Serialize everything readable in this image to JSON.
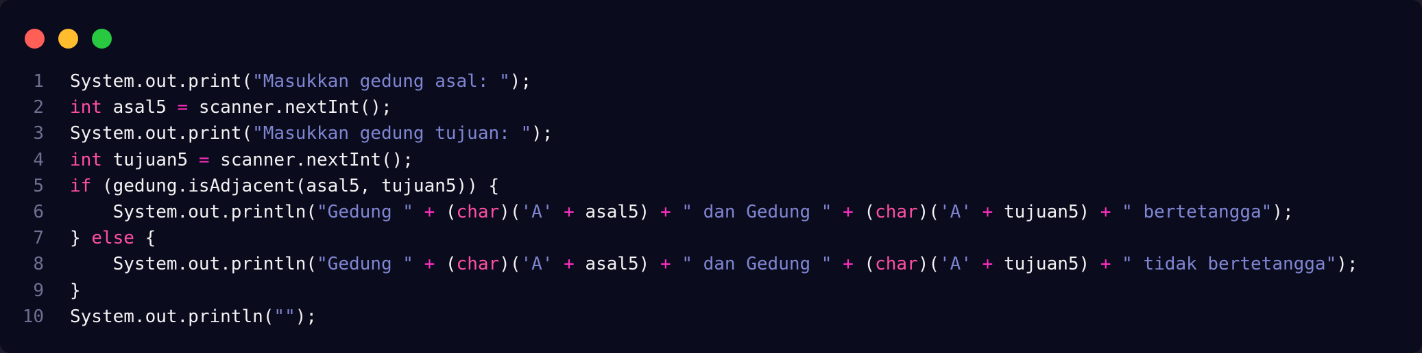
{
  "window": {
    "traffic_lights": [
      {
        "name": "close",
        "color": "#ff5f57"
      },
      {
        "name": "minimize",
        "color": "#febc2e"
      },
      {
        "name": "zoom",
        "color": "#28c840"
      }
    ]
  },
  "colors": {
    "background": "#0b0b1e",
    "keyword": "#ff4fa3",
    "string": "#7f86d2",
    "operator": "#ff2fc0",
    "line_number": "#6e7191",
    "text": "#f2f2f2"
  },
  "code": {
    "lines": [
      {
        "num": "1",
        "tokens": [
          {
            "t": "System.out.print(",
            "k": "plain"
          },
          {
            "t": "\"Masukkan gedung asal: \"",
            "k": "str"
          },
          {
            "t": ");",
            "k": "plain"
          }
        ]
      },
      {
        "num": "2",
        "tokens": [
          {
            "t": "int",
            "k": "kw"
          },
          {
            "t": " asal5 ",
            "k": "plain"
          },
          {
            "t": "=",
            "k": "op"
          },
          {
            "t": " scanner.nextInt();",
            "k": "plain"
          }
        ]
      },
      {
        "num": "3",
        "tokens": [
          {
            "t": "System.out.print(",
            "k": "plain"
          },
          {
            "t": "\"Masukkan gedung tujuan: \"",
            "k": "str"
          },
          {
            "t": ");",
            "k": "plain"
          }
        ]
      },
      {
        "num": "4",
        "tokens": [
          {
            "t": "int",
            "k": "kw"
          },
          {
            "t": " tujuan5 ",
            "k": "plain"
          },
          {
            "t": "=",
            "k": "op"
          },
          {
            "t": " scanner.nextInt();",
            "k": "plain"
          }
        ]
      },
      {
        "num": "5",
        "tokens": [
          {
            "t": "if",
            "k": "kw"
          },
          {
            "t": " (gedung.isAdjacent(asal5, tujuan5)) {",
            "k": "plain"
          }
        ]
      },
      {
        "num": "6",
        "tokens": [
          {
            "t": "    System.out.println(",
            "k": "plain"
          },
          {
            "t": "\"Gedung \"",
            "k": "str"
          },
          {
            "t": " ",
            "k": "plain"
          },
          {
            "t": "+",
            "k": "op"
          },
          {
            "t": " (",
            "k": "plain"
          },
          {
            "t": "char",
            "k": "kw"
          },
          {
            "t": ")(",
            "k": "plain"
          },
          {
            "t": "'A'",
            "k": "str"
          },
          {
            "t": " ",
            "k": "plain"
          },
          {
            "t": "+",
            "k": "op"
          },
          {
            "t": " asal5) ",
            "k": "plain"
          },
          {
            "t": "+",
            "k": "op"
          },
          {
            "t": " ",
            "k": "plain"
          },
          {
            "t": "\" dan Gedung \"",
            "k": "str"
          },
          {
            "t": " ",
            "k": "plain"
          },
          {
            "t": "+",
            "k": "op"
          },
          {
            "t": " (",
            "k": "plain"
          },
          {
            "t": "char",
            "k": "kw"
          },
          {
            "t": ")(",
            "k": "plain"
          },
          {
            "t": "'A'",
            "k": "str"
          },
          {
            "t": " ",
            "k": "plain"
          },
          {
            "t": "+",
            "k": "op"
          },
          {
            "t": " tujuan5) ",
            "k": "plain"
          },
          {
            "t": "+",
            "k": "op"
          },
          {
            "t": " ",
            "k": "plain"
          },
          {
            "t": "\" bertetangga\"",
            "k": "str"
          },
          {
            "t": ");",
            "k": "plain"
          }
        ]
      },
      {
        "num": "7",
        "tokens": [
          {
            "t": "} ",
            "k": "plain"
          },
          {
            "t": "else",
            "k": "kw"
          },
          {
            "t": " {",
            "k": "plain"
          }
        ]
      },
      {
        "num": "8",
        "tokens": [
          {
            "t": "    System.out.println(",
            "k": "plain"
          },
          {
            "t": "\"Gedung \"",
            "k": "str"
          },
          {
            "t": " ",
            "k": "plain"
          },
          {
            "t": "+",
            "k": "op"
          },
          {
            "t": " (",
            "k": "plain"
          },
          {
            "t": "char",
            "k": "kw"
          },
          {
            "t": ")(",
            "k": "plain"
          },
          {
            "t": "'A'",
            "k": "str"
          },
          {
            "t": " ",
            "k": "plain"
          },
          {
            "t": "+",
            "k": "op"
          },
          {
            "t": " asal5) ",
            "k": "plain"
          },
          {
            "t": "+",
            "k": "op"
          },
          {
            "t": " ",
            "k": "plain"
          },
          {
            "t": "\" dan Gedung \"",
            "k": "str"
          },
          {
            "t": " ",
            "k": "plain"
          },
          {
            "t": "+",
            "k": "op"
          },
          {
            "t": " (",
            "k": "plain"
          },
          {
            "t": "char",
            "k": "kw"
          },
          {
            "t": ")(",
            "k": "plain"
          },
          {
            "t": "'A'",
            "k": "str"
          },
          {
            "t": " ",
            "k": "plain"
          },
          {
            "t": "+",
            "k": "op"
          },
          {
            "t": " tujuan5) ",
            "k": "plain"
          },
          {
            "t": "+",
            "k": "op"
          },
          {
            "t": " ",
            "k": "plain"
          },
          {
            "t": "\" tidak bertetangga\"",
            "k": "str"
          },
          {
            "t": ");",
            "k": "plain"
          }
        ]
      },
      {
        "num": "9",
        "tokens": [
          {
            "t": "}",
            "k": "plain"
          }
        ]
      },
      {
        "num": "10",
        "tokens": [
          {
            "t": "System.out.println(",
            "k": "plain"
          },
          {
            "t": "\"\"",
            "k": "str"
          },
          {
            "t": ");",
            "k": "plain"
          }
        ]
      }
    ]
  }
}
